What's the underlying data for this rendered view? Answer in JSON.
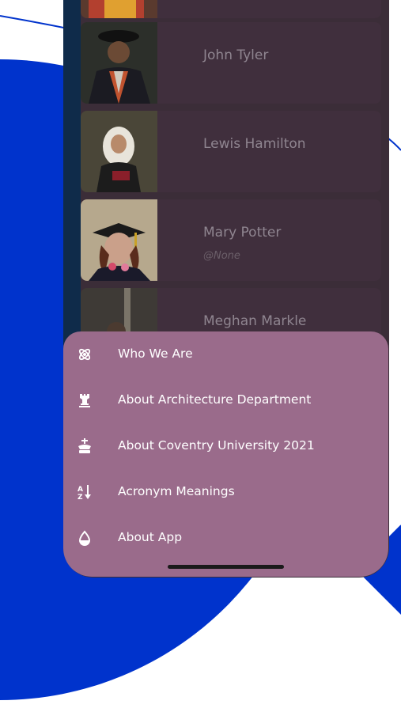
{
  "contacts": [
    {
      "name": "John Tyler",
      "handle": ""
    },
    {
      "name": "Lewis Hamilton",
      "handle": ""
    },
    {
      "name": "Mary Potter",
      "handle": "@None"
    },
    {
      "name": "Meghan Markle",
      "handle": ""
    }
  ],
  "menu": {
    "items": [
      {
        "label": "Who We Are",
        "icon": "atom-icon"
      },
      {
        "label": "About Architecture Department",
        "icon": "rook-icon"
      },
      {
        "label": "About Coventry University 2021",
        "icon": "king-icon"
      },
      {
        "label": "Acronym Meanings",
        "icon": "sort-alpha-icon"
      },
      {
        "label": "About App",
        "icon": "drop-icon"
      }
    ]
  },
  "colors": {
    "accent_blue": "#0033cc",
    "sheet": "#9a6b8b",
    "card": "#402f3d"
  }
}
